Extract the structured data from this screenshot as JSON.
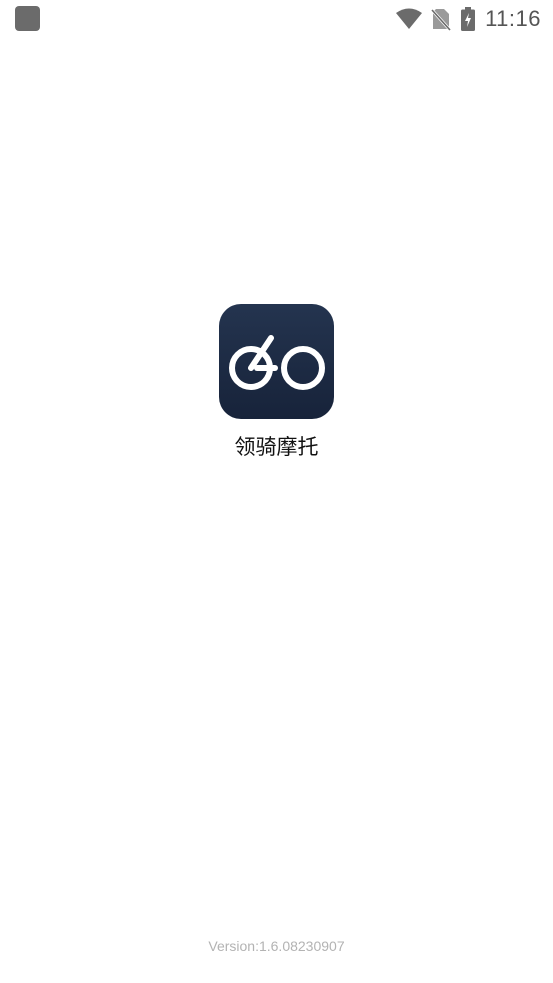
{
  "status_bar": {
    "time": "11:16",
    "icons": [
      "notification-app-icon",
      "wifi-icon",
      "no-sim-icon",
      "battery-charging-icon"
    ]
  },
  "splash": {
    "app_name": "领骑摩托",
    "logo_icon": "bike-logo-icon",
    "logo_gradient": [
      "#24344f",
      "#17233a"
    ],
    "version": "Version:1.6.08230907"
  },
  "colors": {
    "background": "#ffffff",
    "status_icons": "#6b6b6b",
    "version_text": "#b3b3b3"
  }
}
